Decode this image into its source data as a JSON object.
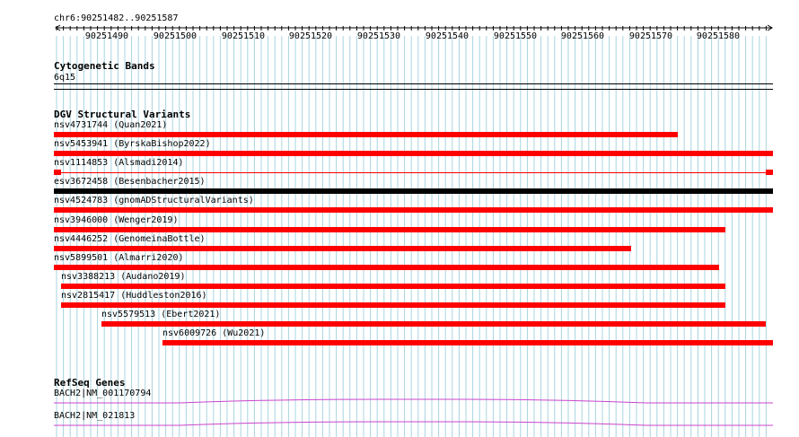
{
  "location": "chr6:90251482..90251587",
  "ruler": {
    "ticks": [
      "90251490",
      "90251500",
      "90251510",
      "90251520",
      "90251530",
      "90251540",
      "90251550",
      "90251560",
      "90251570",
      "90251580"
    ]
  },
  "tracks": {
    "cytobands": {
      "title": "Cytogenetic Bands",
      "band": "6q15"
    },
    "dgv": {
      "title": "DGV Structural Variants",
      "variants": [
        {
          "label": "nsv4731744 (Quan2021)",
          "color": "#ff0000",
          "style": "bar"
        },
        {
          "label": "nsv5453941 (ByrskaBishop2022)",
          "color": "#ff0000",
          "style": "bar"
        },
        {
          "label": "nsv1114853 (Alsmadi2014)",
          "color": "#ff0000",
          "style": "thin-ends"
        },
        {
          "label": "esv3672458 (Besenbacher2015)",
          "color": "#000000",
          "style": "bar"
        },
        {
          "label": "nsv4524783 (gnomADStructuralVariants)",
          "color": "#ff0000",
          "style": "bar"
        },
        {
          "label": "nsv3946000 (Wenger2019)",
          "color": "#ff0000",
          "style": "bar"
        },
        {
          "label": "nsv4446252 (GenomeinaBottle)",
          "color": "#ff0000",
          "style": "bar"
        },
        {
          "label": "nsv5899501 (Almarri2020)",
          "color": "#ff0000",
          "style": "bar"
        },
        {
          "label": "nsv3388213 (Audano2019)",
          "color": "#ff0000",
          "style": "bar"
        },
        {
          "label": "nsv2815417 (Huddleston2016)",
          "color": "#ff0000",
          "style": "bar"
        },
        {
          "label": "nsv5579513 (Ebert2021)",
          "color": "#ff0000",
          "style": "bar"
        },
        {
          "label": "nsv6009726 (Wu2021)",
          "color": "#ff0000",
          "style": "bar"
        }
      ]
    },
    "refseq": {
      "title": "RefSeq Genes",
      "genes": [
        {
          "label": "BACH2|NM_001170794",
          "color": "#cc44cc"
        },
        {
          "label": "BACH2|NM_021813",
          "color": "#cc44cc"
        }
      ]
    }
  },
  "colors": {
    "grid": "#a8d4e0",
    "variant_red": "#ff0000",
    "variant_black": "#000000",
    "gene_magenta": "#cc44cc"
  }
}
